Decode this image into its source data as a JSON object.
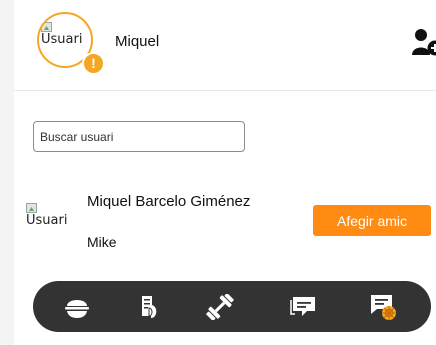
{
  "header": {
    "avatar_alt": "Usuari",
    "alert_symbol": "!",
    "username": "Miquel",
    "add_user_icon": "user-plus-icon"
  },
  "search": {
    "placeholder": "Buscar usuari",
    "value": ""
  },
  "results": [
    {
      "avatar_alt": "Usuari",
      "name": "Miquel Barcelo Giménez",
      "nickname": "Mike",
      "action_label": "Afegir amic"
    }
  ],
  "nav": {
    "items": [
      "food-bowl-icon",
      "nutrition-icon",
      "dumbbell-icon",
      "chat-icon",
      "ai-chat-icon"
    ]
  },
  "colors": {
    "accent": "#ff8b12",
    "ring": "#f5a623",
    "nav_bg": "#333333",
    "nav_icon": "#ffffff"
  }
}
